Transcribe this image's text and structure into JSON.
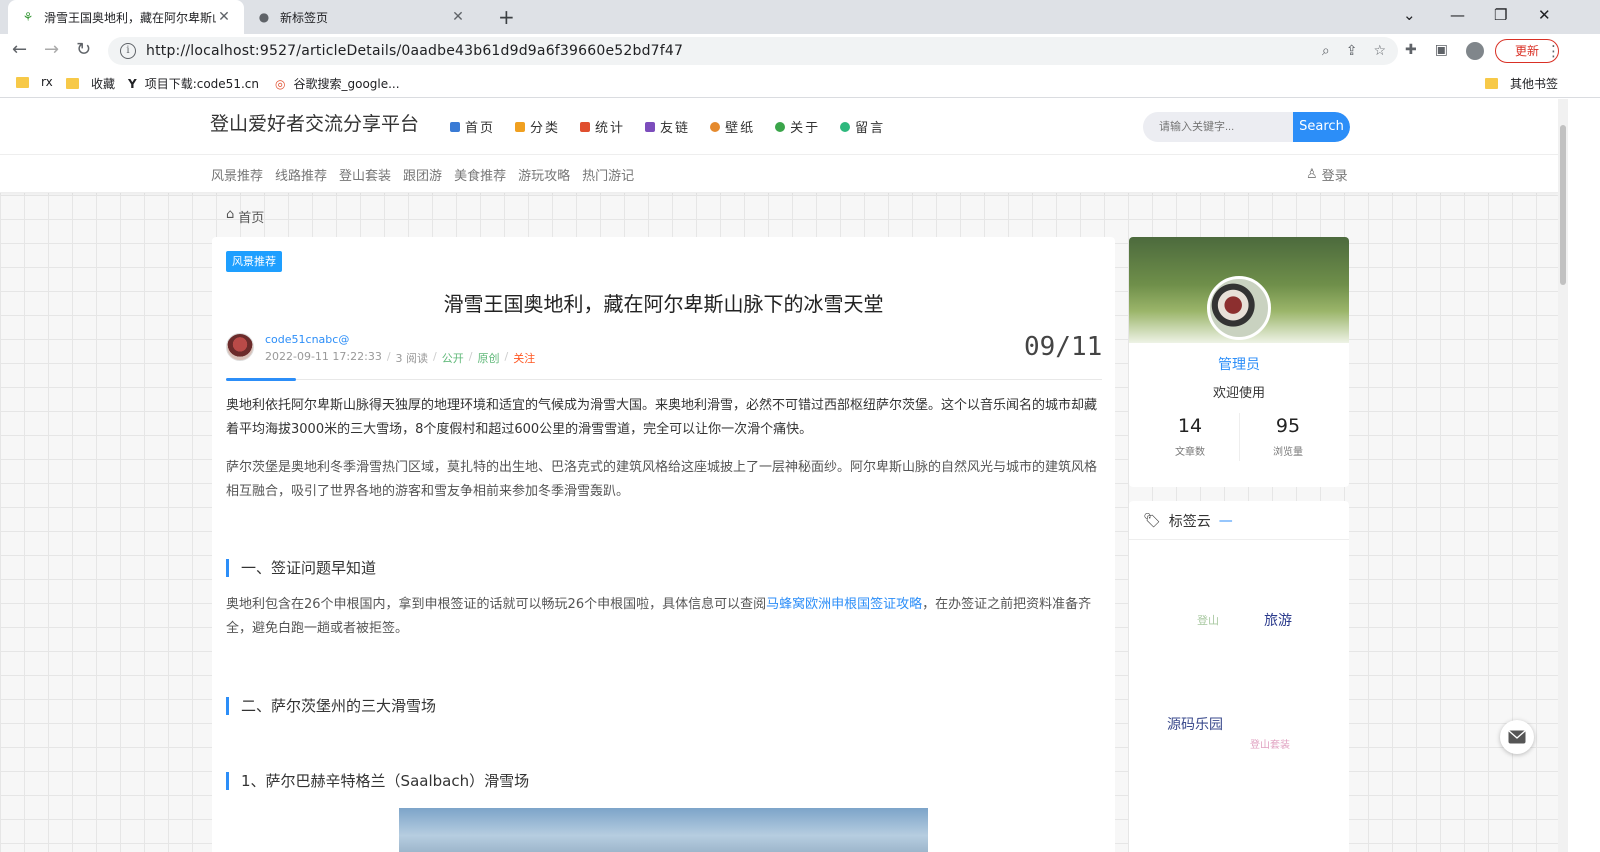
{
  "browser": {
    "tabs": [
      {
        "title": "滑雪王国奥地利，藏在阿尔卑斯山",
        "active": true
      },
      {
        "title": "新标签页",
        "active": false
      }
    ],
    "url": "http://localhost:9527/articleDetails/0aadbe43b61d9d9a6f39660e52bd7f47",
    "update_label": "更新",
    "bookmarks": [
      "rx",
      "收藏",
      "项目下载:code51.cn",
      "谷歌搜索_google...",
      "其他书签"
    ]
  },
  "site": {
    "logo": "登山爱好者交流分享平台",
    "nav": [
      {
        "label": "首页",
        "color": "#3a7bd5"
      },
      {
        "label": "分类",
        "color": "#f0a020"
      },
      {
        "label": "统计",
        "color": "#e04f2f"
      },
      {
        "label": "友链",
        "color": "#7c4dbc"
      },
      {
        "label": "壁纸",
        "color": "#e58a2e"
      },
      {
        "label": "关于",
        "color": "#3aa54a"
      },
      {
        "label": "留言",
        "color": "#2db87d"
      }
    ],
    "search_placeholder": "请输入关键字...",
    "search_button": "Search",
    "subnav": [
      "风景推荐",
      "线路推荐",
      "登山套装",
      "跟团游",
      "美食推荐",
      "游玩攻略",
      "热门游记"
    ],
    "login": "登录"
  },
  "breadcrumb": "首页",
  "article": {
    "category": "风景推荐",
    "title": "滑雪王国奥地利，藏在阿尔卑斯山脉下的冰雪天堂",
    "author": "code51cnabc@",
    "datetime": "2022-09-11 17:22:33",
    "reads": "3 阅读",
    "visibility": "公开",
    "type": "原创",
    "follow": "关注",
    "date_badge": "09/11",
    "p1": "奥地利依托阿尔卑斯山脉得天独厚的地理环境和适宜的气候成为滑雪大国。来奥地利滑雪，必然不可错过西部枢纽萨尔茨堡。这个以音乐闻名的城市却藏着平均海拔3000米的三大雪场，8个度假村和超过600公里的滑雪雪道，完全可以让你一次滑个痛快。",
    "p2": "萨尔茨堡是奥地利冬季滑雪热门区域，莫扎特的出生地、巴洛克式的建筑风格给这座城披上了一层神秘面纱。阿尔卑斯山脉的自然风光与城市的建筑风格相互融合，吸引了世界各地的游客和雪友争相前来参加冬季滑雪轰趴。",
    "h1": "一、签证问题早知道",
    "p3_before": "奥地利包含在26个申根国内，拿到申根签证的话就可以畅玩26个申根国啦，具体信息可以查阅",
    "p3_link": "马蜂窝欧洲申根国签证攻略",
    "p3_after": "，在办签证之前把资料准备齐全，避免白跑一趟或者被拒签。",
    "h2": "二、萨尔茨堡州的三大滑雪场",
    "h3": "1、萨尔巴赫辛特格兰（Saalbach）滑雪场"
  },
  "profile": {
    "name": "管理员",
    "welcome": "欢迎使用",
    "articles_count": "14",
    "articles_label": "文章数",
    "views_count": "95",
    "views_label": "浏览量"
  },
  "tagcloud": {
    "title": "标签云",
    "dash": "—",
    "tags": [
      {
        "label": "登山",
        "color": "#a8c8a0"
      },
      {
        "label": "旅游",
        "color": "#2a3a8c"
      },
      {
        "label": "源码乐园",
        "color": "#3a4a8c"
      },
      {
        "label": "登山套装",
        "color": "#e0a0c0"
      }
    ]
  },
  "colors": {
    "accent": "#2c8ef8",
    "badge": "#1e9fff"
  },
  "icons": [
    "sprout-icon",
    "globe-icon",
    "close-icon",
    "plus-icon",
    "back-icon",
    "forward-icon",
    "reload-icon",
    "info-icon",
    "zoom-icon",
    "share-icon",
    "star-icon",
    "puzzle-icon",
    "sidebar-icon",
    "profile-icon",
    "folder-icon",
    "home-icon",
    "user-icon",
    "tag-icon",
    "mail-icon"
  ]
}
